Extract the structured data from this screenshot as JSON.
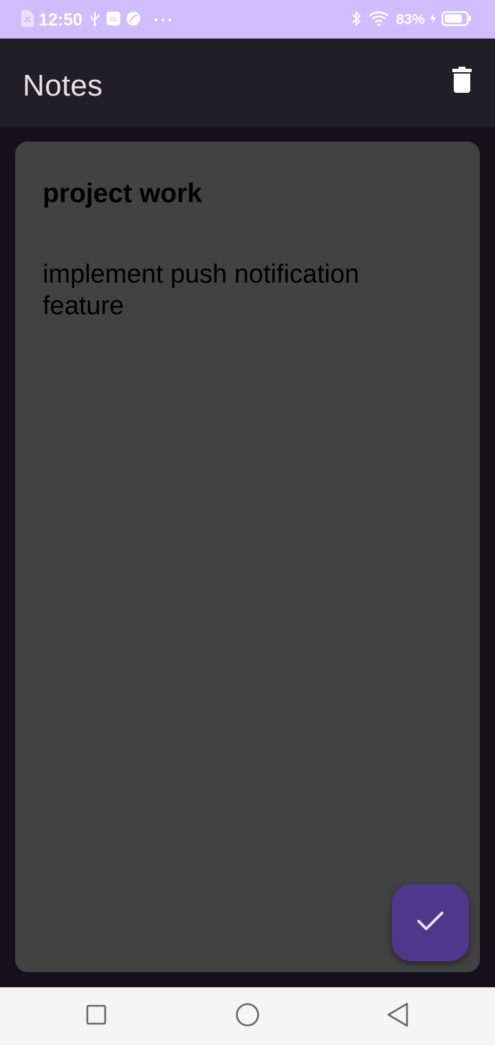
{
  "status_bar": {
    "time": "12:50",
    "battery_percent": "83%",
    "left_icons": [
      "sim-icon",
      "usb-icon",
      "app-notification-icon",
      "leaf-icon",
      "more-dots-icon"
    ],
    "right_icons": [
      "bluetooth-icon",
      "wifi-icon",
      "charging-icon",
      "battery-icon"
    ],
    "battery_level": 0.83,
    "background": "#d0bcff"
  },
  "app_bar": {
    "title": "Notes",
    "action_icon": "trash-icon",
    "background": "#201f25"
  },
  "note": {
    "title": "project work",
    "body": "implement push notification feature",
    "background": "#424242"
  },
  "fab": {
    "icon": "check-icon",
    "color": "#4f378b"
  },
  "nav_bar": {
    "buttons": [
      "recents-icon",
      "home-icon",
      "back-icon"
    ],
    "background": "#f5f5f5"
  }
}
